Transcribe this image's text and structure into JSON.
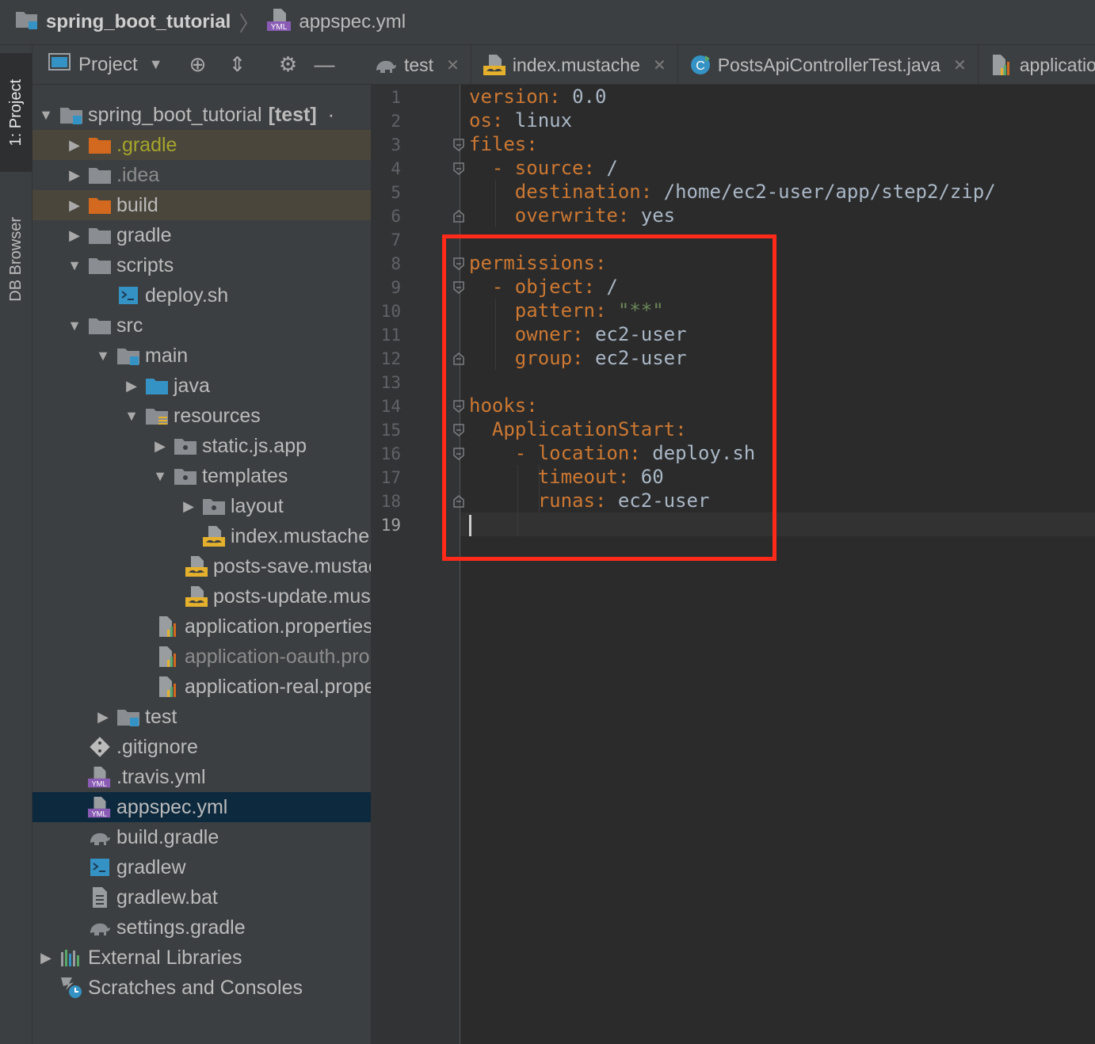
{
  "breadcrumb": {
    "project": "spring_boot_tutorial",
    "file": "appspec.yml",
    "file_badge": "YML"
  },
  "tool_stripe": {
    "project_tab": "1: Project",
    "db_tab": "DB Browser"
  },
  "project_panel": {
    "title": "Project",
    "tree": [
      {
        "label": "spring_boot_tutorial",
        "suffix": "[test]",
        "extra": "·",
        "depth": 0,
        "arrow": "down",
        "icon": "module-folder-icon"
      },
      {
        "label": ".gradle",
        "depth": 1,
        "arrow": "right",
        "icon": "excluded-folder-icon",
        "style": "olive",
        "highlight": true
      },
      {
        "label": ".idea",
        "depth": 1,
        "arrow": "right",
        "icon": "folder-icon",
        "style": "dim"
      },
      {
        "label": "build",
        "depth": 1,
        "arrow": "right",
        "icon": "excluded-folder-icon",
        "highlight": true
      },
      {
        "label": "gradle",
        "depth": 1,
        "arrow": "right",
        "icon": "folder-icon"
      },
      {
        "label": "scripts",
        "depth": 1,
        "arrow": "down",
        "icon": "folder-icon"
      },
      {
        "label": "deploy.sh",
        "depth": 2,
        "arrow": "",
        "icon": "shell-script-icon"
      },
      {
        "label": "src",
        "depth": 1,
        "arrow": "down",
        "icon": "folder-icon"
      },
      {
        "label": "main",
        "depth": 2,
        "arrow": "down",
        "icon": "module-folder-icon"
      },
      {
        "label": "java",
        "depth": 3,
        "arrow": "right",
        "icon": "source-folder-icon"
      },
      {
        "label": "resources",
        "depth": 3,
        "arrow": "down",
        "icon": "resources-folder-icon"
      },
      {
        "label": "static.js.app",
        "depth": 4,
        "arrow": "right",
        "icon": "package-folder-icon"
      },
      {
        "label": "templates",
        "depth": 4,
        "arrow": "down",
        "icon": "package-folder-icon"
      },
      {
        "label": "layout",
        "depth": 5,
        "arrow": "right",
        "icon": "package-folder-icon"
      },
      {
        "label": "index.mustache",
        "depth": 5,
        "arrow": "",
        "icon": "mustache-file-icon"
      },
      {
        "label": "posts-save.mustache",
        "depth": 5,
        "arrow": "",
        "icon": "mustache-file-icon"
      },
      {
        "label": "posts-update.mustache",
        "depth": 5,
        "arrow": "",
        "icon": "mustache-file-icon"
      },
      {
        "label": "application.properties",
        "depth": 4,
        "arrow": "",
        "icon": "properties-file-icon"
      },
      {
        "label": "application-oauth.properties",
        "depth": 4,
        "arrow": "",
        "icon": "properties-file-icon",
        "style": "dim"
      },
      {
        "label": "application-real.properties",
        "depth": 4,
        "arrow": "",
        "icon": "properties-file-icon"
      },
      {
        "label": "test",
        "depth": 2,
        "arrow": "right",
        "icon": "module-folder-icon"
      },
      {
        "label": ".gitignore",
        "depth": 1,
        "arrow": "",
        "icon": "git-ignore-icon"
      },
      {
        "label": ".travis.yml",
        "depth": 1,
        "arrow": "",
        "icon": "yaml-file-icon"
      },
      {
        "label": "appspec.yml",
        "depth": 1,
        "arrow": "",
        "icon": "yaml-file-icon",
        "selected": true
      },
      {
        "label": "build.gradle",
        "depth": 1,
        "arrow": "",
        "icon": "gradle-file-icon"
      },
      {
        "label": "gradlew",
        "depth": 1,
        "arrow": "",
        "icon": "shell-script-icon"
      },
      {
        "label": "gradlew.bat",
        "depth": 1,
        "arrow": "",
        "icon": "text-file-icon"
      },
      {
        "label": "settings.gradle",
        "depth": 1,
        "arrow": "",
        "icon": "gradle-file-icon"
      },
      {
        "label": "External Libraries",
        "depth": 0,
        "arrow": "right",
        "icon": "libraries-icon"
      },
      {
        "label": "Scratches and Consoles",
        "depth": 0,
        "arrow": "",
        "icon": "scratches-icon"
      }
    ]
  },
  "editor_tabs": [
    {
      "label": "test",
      "icon": "gradle-file-icon"
    },
    {
      "label": "index.mustache",
      "icon": "mustache-file-icon"
    },
    {
      "label": "PostsApiControllerTest.java",
      "icon": "java-class-icon"
    },
    {
      "label": "application.properties",
      "icon": "properties-file-icon"
    }
  ],
  "editor": {
    "lines": [
      [
        {
          "t": "version",
          "c": "k"
        },
        {
          "t": ": ",
          "c": "p"
        },
        {
          "t": "0.0",
          "c": "v"
        }
      ],
      [
        {
          "t": "os",
          "c": "k"
        },
        {
          "t": ": ",
          "c": "p"
        },
        {
          "t": "linux",
          "c": "v"
        }
      ],
      [
        {
          "t": "files",
          "c": "k"
        },
        {
          "t": ":",
          "c": "p"
        }
      ],
      [
        {
          "t": "  - ",
          "c": "p"
        },
        {
          "t": "source",
          "c": "k"
        },
        {
          "t": ": ",
          "c": "p"
        },
        {
          "t": "/",
          "c": "v"
        }
      ],
      [
        {
          "t": "    destination",
          "c": "k"
        },
        {
          "t": ": ",
          "c": "p"
        },
        {
          "t": "/home/ec2-user/app/step2/zip/",
          "c": "v"
        }
      ],
      [
        {
          "t": "    overwrite",
          "c": "k"
        },
        {
          "t": ": ",
          "c": "p"
        },
        {
          "t": "yes",
          "c": "v"
        }
      ],
      [],
      [
        {
          "t": "permissions",
          "c": "k"
        },
        {
          "t": ":",
          "c": "p"
        }
      ],
      [
        {
          "t": "  - ",
          "c": "p"
        },
        {
          "t": "object",
          "c": "k"
        },
        {
          "t": ": ",
          "c": "p"
        },
        {
          "t": "/",
          "c": "v"
        }
      ],
      [
        {
          "t": "    pattern",
          "c": "k"
        },
        {
          "t": ": ",
          "c": "p"
        },
        {
          "t": "\"**\"",
          "c": "s"
        }
      ],
      [
        {
          "t": "    owner",
          "c": "k"
        },
        {
          "t": ": ",
          "c": "p"
        },
        {
          "t": "ec2-user",
          "c": "v"
        }
      ],
      [
        {
          "t": "    group",
          "c": "k"
        },
        {
          "t": ": ",
          "c": "p"
        },
        {
          "t": "ec2-user",
          "c": "v"
        }
      ],
      [],
      [
        {
          "t": "hooks",
          "c": "k"
        },
        {
          "t": ":",
          "c": "p"
        }
      ],
      [
        {
          "t": "  ApplicationStart",
          "c": "k"
        },
        {
          "t": ":",
          "c": "p"
        }
      ],
      [
        {
          "t": "    - ",
          "c": "p"
        },
        {
          "t": "location",
          "c": "k"
        },
        {
          "t": ": ",
          "c": "p"
        },
        {
          "t": "deploy.sh",
          "c": "v"
        }
      ],
      [
        {
          "t": "      timeout",
          "c": "k"
        },
        {
          "t": ": ",
          "c": "p"
        },
        {
          "t": "60",
          "c": "v"
        }
      ],
      [
        {
          "t": "      runas",
          "c": "k"
        },
        {
          "t": ": ",
          "c": "p"
        },
        {
          "t": "ec2-user",
          "c": "v"
        }
      ],
      []
    ],
    "current_line": 19,
    "highlight_color": "#ff2a1a"
  },
  "colors": {
    "key": "#cc7832",
    "value": "#a9b7c6",
    "string": "#6a8759",
    "selection": "#0d293e"
  }
}
